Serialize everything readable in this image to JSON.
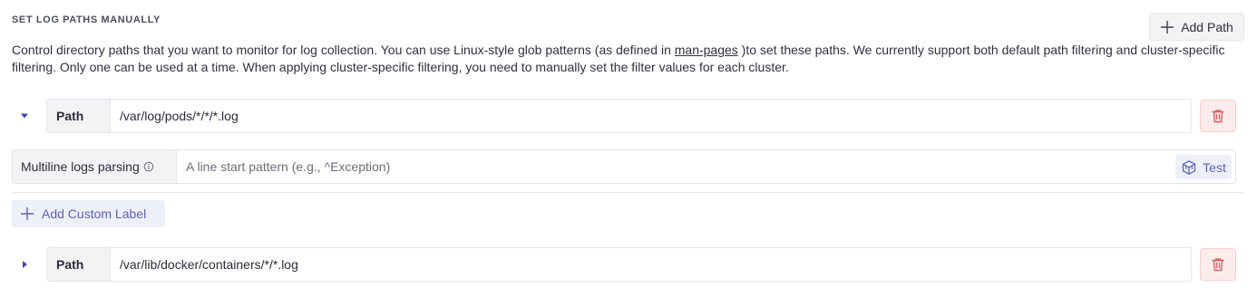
{
  "section": {
    "title": "SET LOG PATHS MANUALLY",
    "add_path_label": "Add Path"
  },
  "description": {
    "before_link": "Control directory paths that you want to monitor for log collection. You can use Linux-style glob patterns (as defined in ",
    "link_text": "man-pages",
    "after_link": " )to set these paths. We currently support both default path filtering and cluster-specific filtering. Only one can be used at a time. When applying cluster-specific filtering, you need to manually set the filter values for each cluster."
  },
  "paths": [
    {
      "label": "Path",
      "value": "/var/log/pods/*/*/*.log",
      "expanded": true,
      "multiline_label": "Multiline logs parsing",
      "multiline_placeholder": "A line start pattern (e.g., ^Exception)",
      "test_label": "Test",
      "add_custom_label": "Add Custom Label"
    },
    {
      "label": "Path",
      "value": "/var/lib/docker/containers/*/*.log",
      "expanded": false
    }
  ],
  "colors": {
    "accent": "#5b63b8",
    "danger": "#e05a5a",
    "caret": "#3b4bb0"
  },
  "icons": {
    "add_path": "plus-icon",
    "caret_expanded": "caret-down-icon",
    "caret_collapsed": "caret-right-icon",
    "delete": "trash-icon",
    "info": "info-icon",
    "test": "cube-icon",
    "add_label": "plus-icon"
  }
}
